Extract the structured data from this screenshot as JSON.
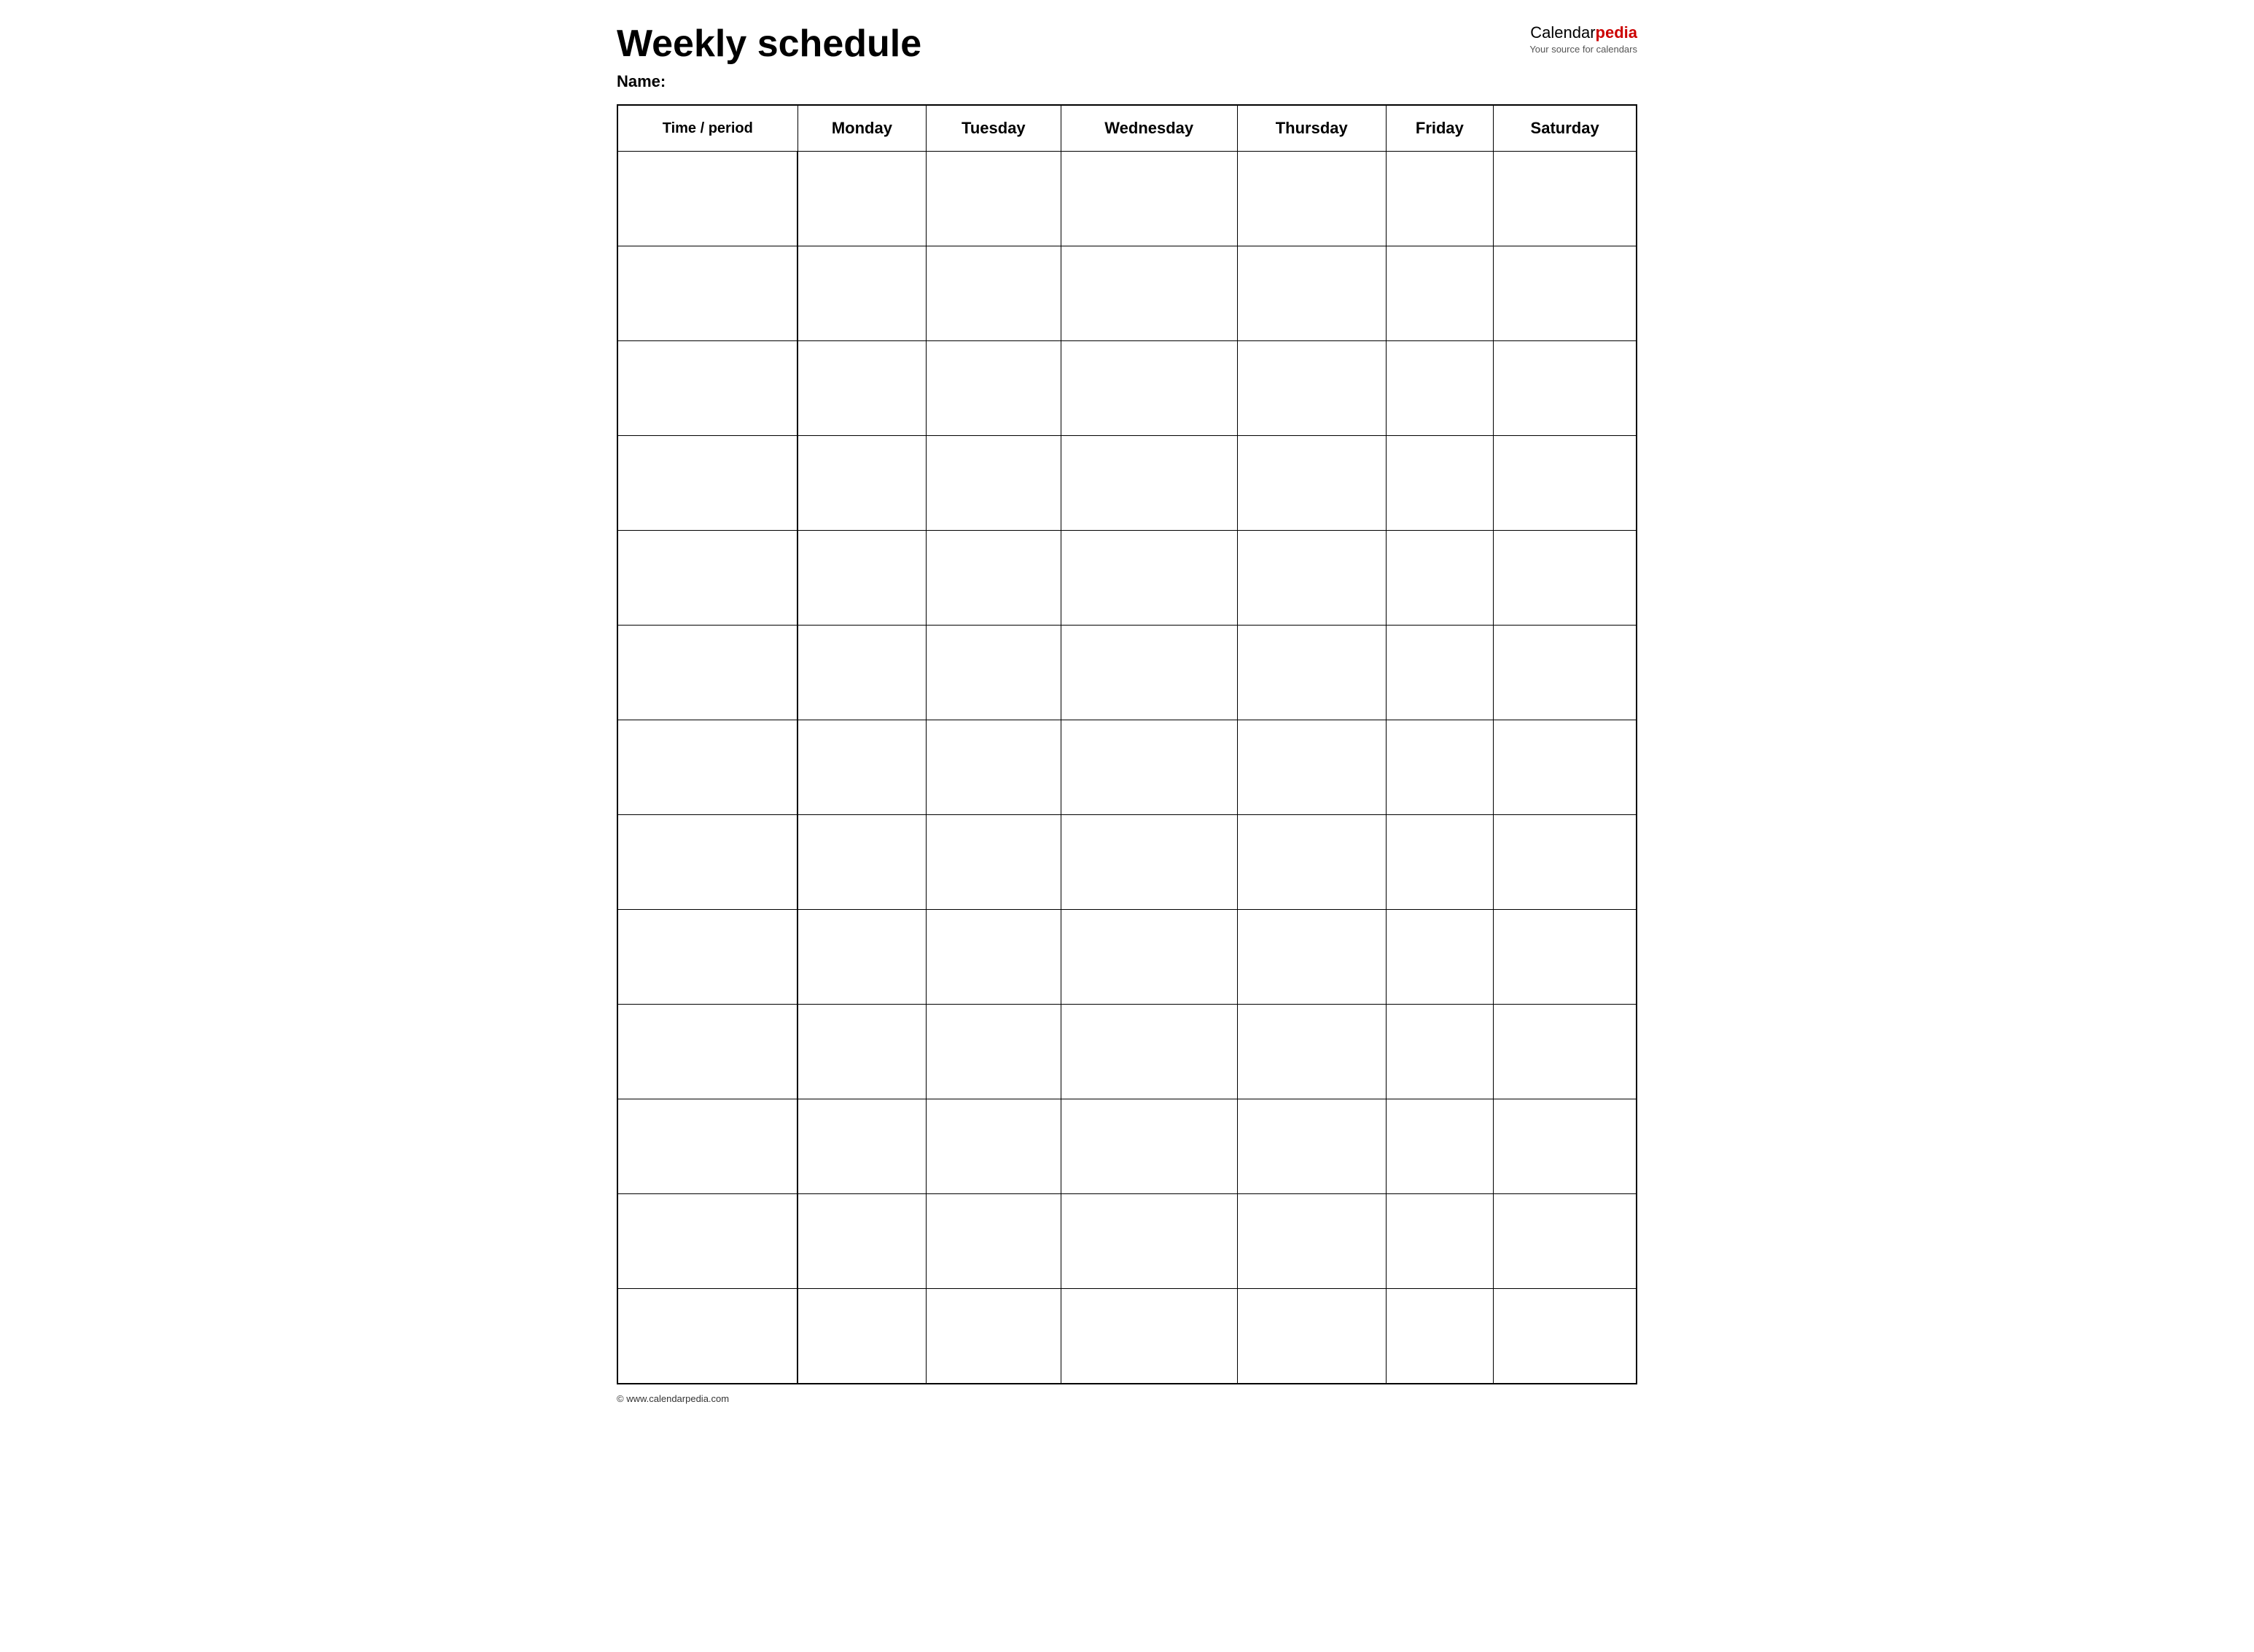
{
  "header": {
    "title": "Weekly schedule",
    "name_label": "Name:",
    "logo": {
      "calendar_text": "Calendar",
      "pedia_text": "pedia",
      "subtitle": "Your source for calendars"
    }
  },
  "table": {
    "columns": [
      {
        "id": "time",
        "label": "Time / period"
      },
      {
        "id": "monday",
        "label": "Monday"
      },
      {
        "id": "tuesday",
        "label": "Tuesday"
      },
      {
        "id": "wednesday",
        "label": "Wednesday"
      },
      {
        "id": "thursday",
        "label": "Thursday"
      },
      {
        "id": "friday",
        "label": "Friday"
      },
      {
        "id": "saturday",
        "label": "Saturday"
      }
    ],
    "row_count": 13
  },
  "footer": {
    "text": "© www.calendarpedia.com"
  }
}
